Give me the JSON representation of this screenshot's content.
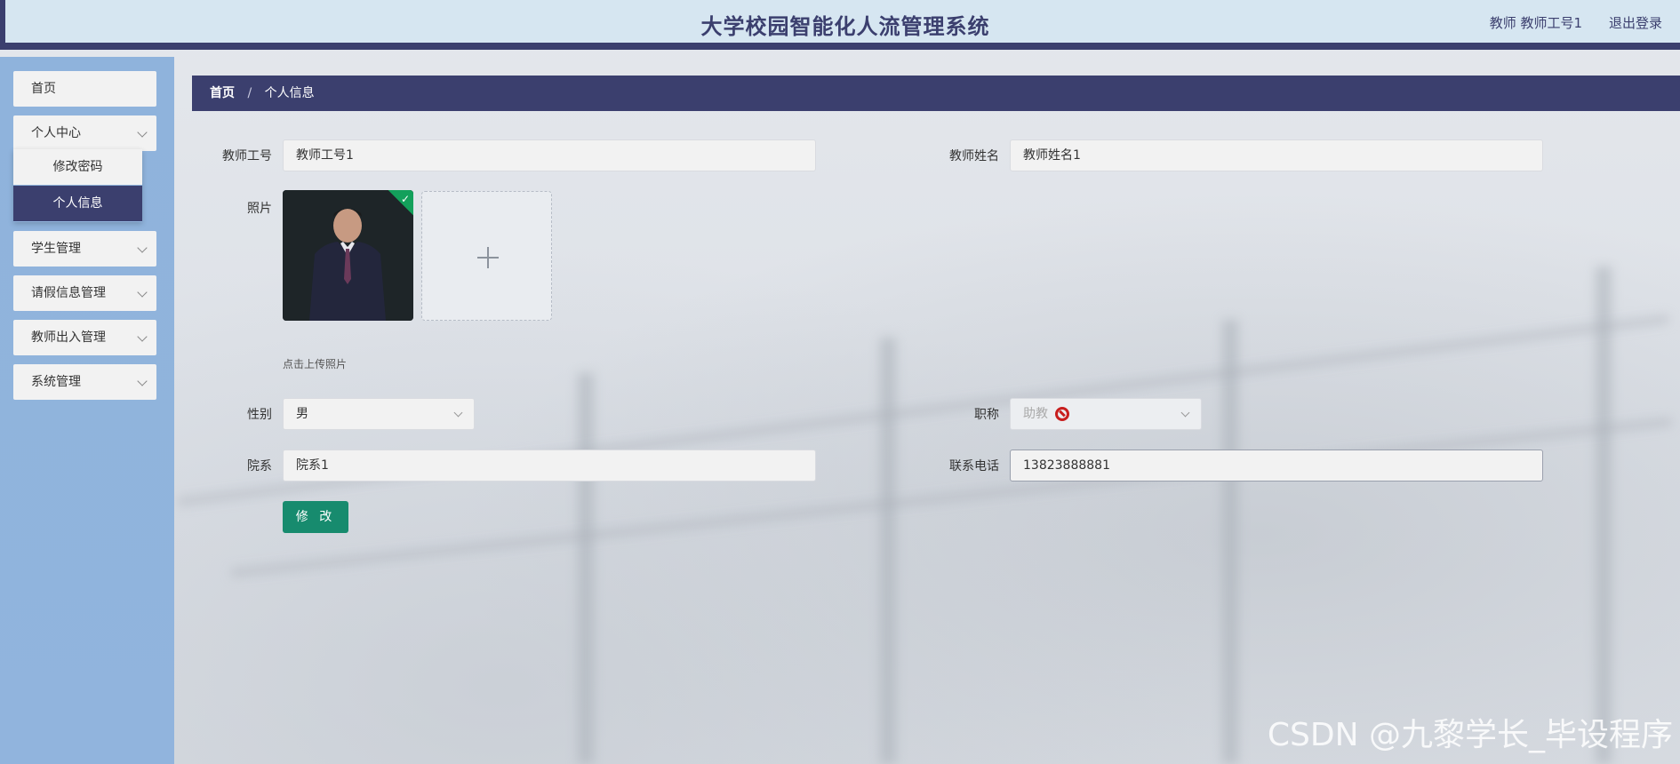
{
  "header": {
    "title": "大学校园智能化人流管理系统",
    "user": "教师 教师工号1",
    "logout": "退出登录"
  },
  "sidebar": {
    "items": [
      {
        "label": "首页"
      },
      {
        "label": "个人中心",
        "has_arrow": true
      },
      {
        "label": "学生管理",
        "has_arrow": true
      },
      {
        "label": "请假信息管理",
        "has_arrow": true
      },
      {
        "label": "教师出入管理",
        "has_arrow": true
      },
      {
        "label": "系统管理",
        "has_arrow": true
      }
    ],
    "submenu": [
      {
        "label": "修改密码"
      },
      {
        "label": "个人信息",
        "active": true
      }
    ]
  },
  "breadcrumb": {
    "home": "首页",
    "separator": "/",
    "current": "个人信息"
  },
  "form": {
    "teacher_id_label": "教师工号",
    "teacher_id_value": "教师工号1",
    "teacher_name_label": "教师姓名",
    "teacher_name_value": "教师姓名1",
    "photo_label": "照片",
    "upload_hint": "点击上传照片",
    "gender_label": "性别",
    "gender_value": "男",
    "title_label": "职称",
    "title_value": "助教",
    "department_label": "院系",
    "department_value": "院系1",
    "phone_label": "联系电话",
    "phone_value": "13823888881",
    "submit_label": "修 改"
  },
  "watermark": "CSDN @九黎学长_毕设程序",
  "colors": {
    "primary": "#3b3f6e",
    "sidebar": "#8fb3dc",
    "button": "#178b6e",
    "success": "#13a05b"
  }
}
